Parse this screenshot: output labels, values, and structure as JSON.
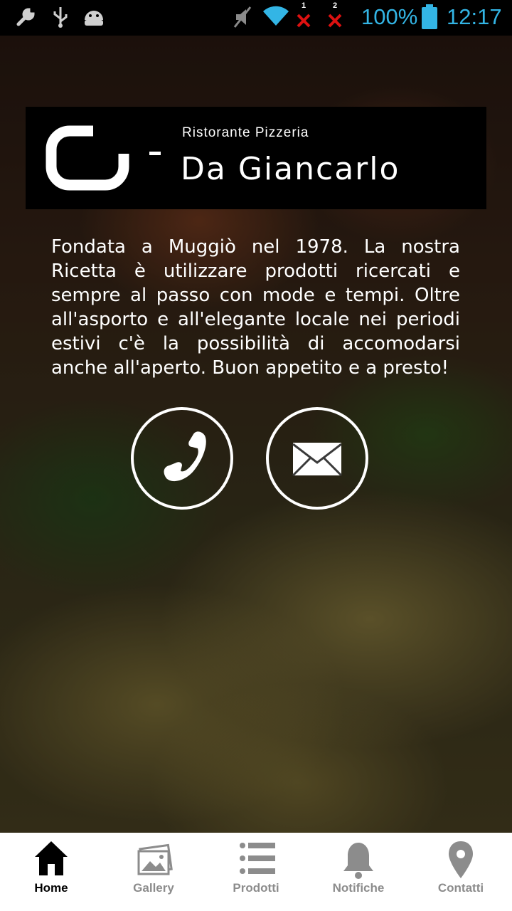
{
  "status_bar": {
    "battery_percent": "100%",
    "time": "12:17",
    "sim1_label": "1",
    "sim2_label": "2",
    "icons": [
      "wrench-icon",
      "usb-icon",
      "android-icon",
      "mute-icon",
      "wifi-icon",
      "no-signal-icon",
      "no-signal-icon",
      "battery-icon"
    ],
    "accent_color": "#33b5e5"
  },
  "logo": {
    "subtitle": "Ristorante Pizzeria",
    "brand": "Da Giancarlo"
  },
  "description": "Fondata a Muggiò nel 1978. La nostra Ricetta è utilizzare prodotti ricercati e sempre al passo con mode e tempi. Oltre all'asporto e all'elegante locale nei periodi estivi c'è la possibilità di accomodarsi anche all'aperto. Buon appetito e a presto!",
  "actions": [
    {
      "icon": "phone-icon"
    },
    {
      "icon": "mail-icon"
    }
  ],
  "bottom_nav": {
    "items": [
      {
        "label": "Home",
        "icon": "home-icon",
        "active": true
      },
      {
        "label": "Gallery",
        "icon": "gallery-icon",
        "active": false
      },
      {
        "label": "Prodotti",
        "icon": "list-icon",
        "active": false
      },
      {
        "label": "Notifiche",
        "icon": "bell-icon",
        "active": false
      },
      {
        "label": "Contatti",
        "icon": "location-pin-icon",
        "active": false
      }
    ],
    "active_color": "#000000",
    "inactive_color": "#8c8c8c"
  }
}
